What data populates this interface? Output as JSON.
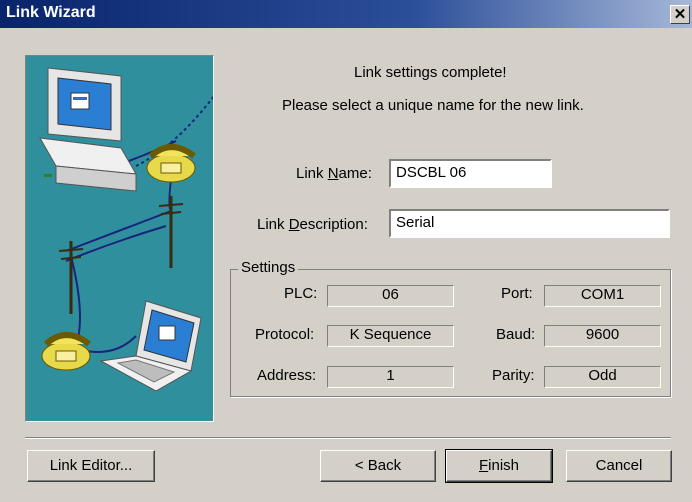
{
  "window": {
    "title": "Link Wizard",
    "close_glyph": "✕"
  },
  "header": {
    "line1": "Link settings complete!",
    "line2": "Please select a unique name for the new link."
  },
  "form": {
    "link_name": {
      "label_pre": "Link ",
      "label_key": "N",
      "label_post": "ame:",
      "value": "DSCBL 06"
    },
    "link_description": {
      "label_pre": "Link ",
      "label_key": "D",
      "label_post": "escription:",
      "value": "Serial"
    }
  },
  "settings": {
    "legend": "Settings",
    "plc": {
      "label": "PLC:",
      "value": "06"
    },
    "protocol": {
      "label": "Protocol:",
      "value": "K Sequence"
    },
    "address": {
      "label": "Address:",
      "value": "1"
    },
    "port": {
      "label": "Port:",
      "value": "COM1"
    },
    "baud": {
      "label": "Baud:",
      "value": "9600"
    },
    "parity": {
      "label": "Parity:",
      "value": "Odd"
    }
  },
  "buttons": {
    "link_editor": "Link Editor...",
    "back": "< Back",
    "finish_key": "F",
    "finish_rest": "inish",
    "cancel": "Cancel"
  },
  "colors": {
    "illustration_bg": "#2f8f9d",
    "titlebar": "#08246b",
    "dialog_bg": "#d4d0c8"
  }
}
